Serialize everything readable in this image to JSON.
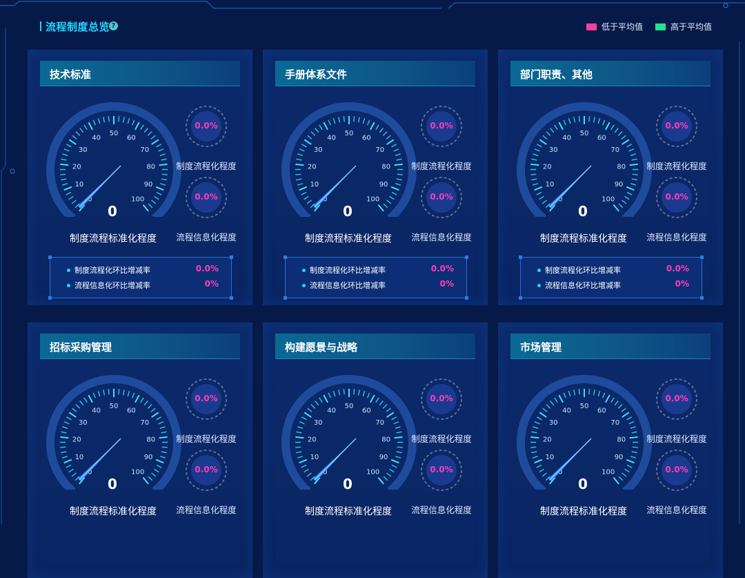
{
  "header": {
    "title": "流程制度总览",
    "help_icon": "?",
    "legend": [
      {
        "label": "低于平均值",
        "color": "#ff3d9a"
      },
      {
        "label": "高于平均值",
        "color": "#22e38a"
      }
    ]
  },
  "gauge_ticks": [
    "0",
    "10",
    "20",
    "30",
    "40",
    "50",
    "60",
    "70",
    "80",
    "90",
    "100"
  ],
  "cards": [
    {
      "title": "技术标准",
      "gauge_value": "0",
      "gauge_label": "制度流程标准化程度",
      "ring1_value": "0.0%",
      "ring1_label": "制度流程化程度",
      "ring2_value": "0.0%",
      "ring2_label": "流程信息化程度",
      "stat1_label": "制度流程化环比增减率",
      "stat1_value": "0.0%",
      "stat2_label": "流程信息化环比增减率",
      "stat2_value": "0%"
    },
    {
      "title": "手册体系文件",
      "gauge_value": "0",
      "gauge_label": "制度流程标准化程度",
      "ring1_value": "0.0%",
      "ring1_label": "制度流程化程度",
      "ring2_value": "0.0%",
      "ring2_label": "流程信息化程度",
      "stat1_label": "制度流程化环比增减率",
      "stat1_value": "0.0%",
      "stat2_label": "流程信息化环比增减率",
      "stat2_value": "0%"
    },
    {
      "title": "部门职责、其他",
      "gauge_value": "0",
      "gauge_label": "制度流程标准化程度",
      "ring1_value": "0.0%",
      "ring1_label": "制度流程化程度",
      "ring2_value": "0.0%",
      "ring2_label": "流程信息化程度",
      "stat1_label": "制度流程化环比增减率",
      "stat1_value": "0.0%",
      "stat2_label": "流程信息化环比增减率",
      "stat2_value": "0%"
    },
    {
      "title": "招标采购管理",
      "gauge_value": "0",
      "gauge_label": "制度流程标准化程度",
      "ring1_value": "0.0%",
      "ring1_label": "制度流程化程度",
      "ring2_value": "0.0%",
      "ring2_label": "流程信息化程度",
      "stat1_label": "",
      "stat1_value": "",
      "stat2_label": "",
      "stat2_value": ""
    },
    {
      "title": "构建愿景与战略",
      "gauge_value": "0",
      "gauge_label": "制度流程标准化程度",
      "ring1_value": "0.0%",
      "ring1_label": "制度流程化程度",
      "ring2_value": "0.0%",
      "ring2_label": "流程信息化程度",
      "stat1_label": "",
      "stat1_value": "",
      "stat2_label": "",
      "stat2_value": ""
    },
    {
      "title": "市场管理",
      "gauge_value": "0",
      "gauge_label": "制度流程标准化程度",
      "ring1_value": "0.0%",
      "ring1_label": "制度流程化程度",
      "ring2_value": "0.0%",
      "ring2_label": "流程信息化程度",
      "stat1_label": "",
      "stat1_value": "",
      "stat2_label": "",
      "stat2_value": ""
    }
  ],
  "colors": {
    "accent": "#21d6ff",
    "pink": "#ff3db5",
    "tick": "#3fe0ff"
  }
}
